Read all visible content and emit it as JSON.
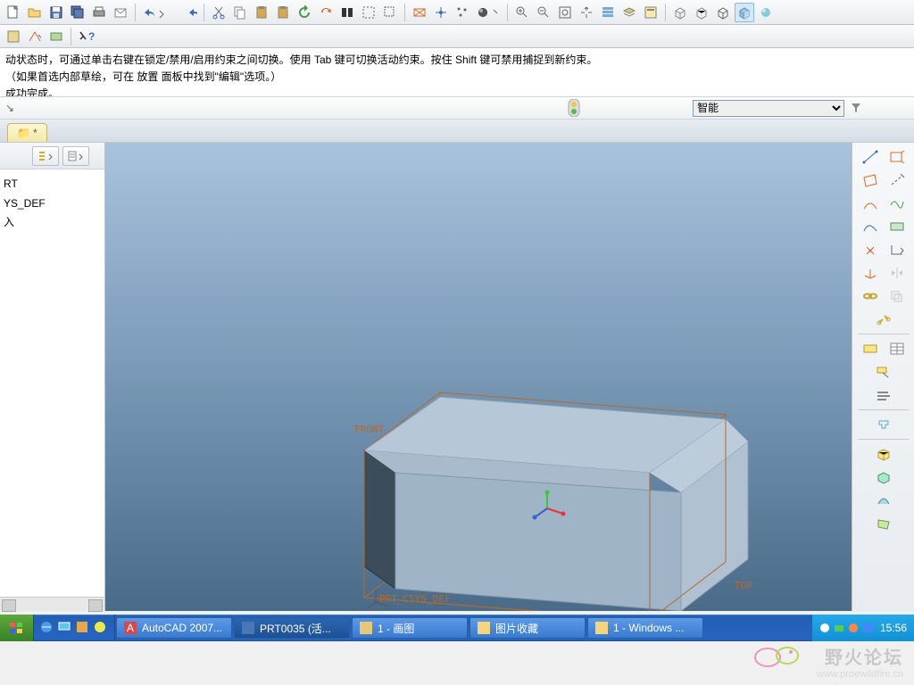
{
  "toolbar_icons": [
    "new",
    "open",
    "save",
    "save-copy",
    "print",
    "email",
    "undo",
    "redo",
    "cut",
    "copy",
    "paste",
    "paste-special",
    "update",
    "regen",
    "find",
    "select",
    "measure",
    "sketch",
    "annotate",
    "render",
    "sphere",
    "zoom-in",
    "zoom-out",
    "zoom-fit",
    "refit",
    "named-views",
    "layers",
    "appearance",
    "iso",
    "front",
    "top",
    "right",
    "shade",
    "plane-display"
  ],
  "help_icon": "?",
  "messages": {
    "line1": "动状态时，可通过单击右键在锁定/禁用/启用约束之间切换。使用 Tab 键可切换活动约束。按住 Shift 键可禁用捕捉到新约束。",
    "line2": "（如果首选内部草绘，可在 放置 面板中找到\"编辑\"选项。）",
    "line3": "成功完成。",
    "line4": "(。"
  },
  "status": {
    "dropdown": "智能"
  },
  "tabs": {
    "active": "*"
  },
  "tree": {
    "btn1": "settings",
    "btn2": "show",
    "items": [
      "RT",
      "",
      "",
      "YS_DEF",
      "",
      "",
      "入"
    ]
  },
  "viewport": {
    "label_front": "FRONT",
    "label_top": "TOP",
    "label_csys": "PRT_CSYS_DEF"
  },
  "right_tools": [
    [
      "line",
      "datum-plane"
    ],
    [
      "plane",
      "axis"
    ],
    [
      "arc",
      "curve"
    ],
    [
      "spline",
      "style"
    ],
    [
      "point",
      "coord"
    ],
    [
      "trim",
      "mirror"
    ],
    [
      "chain",
      "offset"
    ],
    [
      "link",
      ""
    ],
    [
      "sep"
    ],
    [
      "annotate",
      "table"
    ],
    [
      "leader",
      ""
    ],
    [
      "note",
      ""
    ],
    [
      "sep"
    ],
    [
      "draft",
      ""
    ],
    [
      "sep"
    ],
    [
      "extrude",
      ""
    ],
    [
      "revolve",
      ""
    ],
    [
      "sweep",
      ""
    ],
    [
      "blend",
      ""
    ]
  ],
  "taskbar": {
    "apps": [
      {
        "name": "AutoCAD 2007...",
        "icon": "autocad"
      },
      {
        "name": "PRT0035 (活...",
        "icon": "proe",
        "active": true
      },
      {
        "name": "1 - 画图",
        "icon": "paint"
      },
      {
        "name": "图片收藏",
        "icon": "folder"
      },
      {
        "name": "1 - Windows ...",
        "icon": "folder"
      }
    ],
    "time": "15:56"
  },
  "watermark": {
    "title": "野火论坛",
    "url": "www.proewildfire.cn"
  }
}
